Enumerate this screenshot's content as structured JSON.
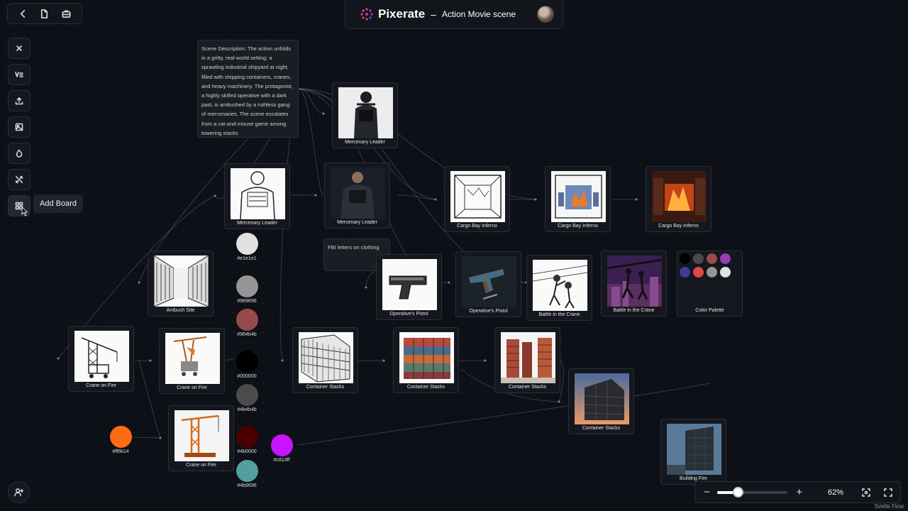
{
  "header": {
    "brand": "Pixerate",
    "separator": "–",
    "scene_title": "Action Movie scene"
  },
  "toolbar": {
    "icons": [
      "back-arrow-icon",
      "document-icon",
      "briefcase-icon"
    ]
  },
  "sidebar": {
    "items": [
      {
        "name": "close-icon"
      },
      {
        "name": "text-icon"
      },
      {
        "name": "upload-icon"
      },
      {
        "name": "image-icon"
      },
      {
        "name": "drop-icon"
      },
      {
        "name": "tools-icon"
      },
      {
        "name": "add-board-icon"
      }
    ],
    "tooltip": "Add Board"
  },
  "nodes": {
    "scene_description": "Scene Description: The action unfolds in a gritty, real-world setting: a sprawling industrial shipyard at night, filled with shipping containers, cranes, and heavy machinery. The protagonist, a highly skilled operative with a dark past, is ambushed by a ruthless gang of mercenaries. The scene escalates from a cat-and-mouse game among towering stacks",
    "fbi_note": "FBI letters on clothing",
    "mercenary_leader_top": "Mercenary Leader",
    "mercenary_leader_sketch": "Mercenary Leader",
    "mercenary_leader_color": "Mercenary Leader",
    "cargo_bay_1": "Cargo Bay Inferno",
    "cargo_bay_2": "Cargo Bay Inferno",
    "cargo_bay_3": "Cargo Bay Inferno",
    "ambush_site": "Ambush Site",
    "pistol_1": "Operative's Pistol",
    "pistol_2": "Operative's Pistol",
    "battle_crane_1": "Battle in the Crane",
    "battle_crane_2": "Battle in the Crane",
    "color_palette": "Color Palette",
    "crane_fire_1": "Crane on Fire",
    "crane_fire_2": "Crane on Fire",
    "crane_fire_3": "Crane on Fire",
    "container_stacks_1": "Container Stacks",
    "container_stacks_2": "Container Stacks",
    "container_stacks_3": "Container Stacks",
    "container_stacks_4": "Container Stacks",
    "building_fire": "Building Fire"
  },
  "swatches": {
    "s1": {
      "hex": "#e1e1e1",
      "color": "#e1e1e1"
    },
    "s2": {
      "hex": "#969696",
      "color": "#969696"
    },
    "s3": {
      "hex": "#964b4b",
      "color": "#964b4b"
    },
    "s4": {
      "hex": "#000000",
      "color": "#000000"
    },
    "s5": {
      "hex": "#4b4b4b",
      "color": "#4b4b4b"
    },
    "s6": {
      "hex": "#4b0000",
      "color": "#4b0000"
    },
    "s7": {
      "hex": "#4b9696",
      "color": "#4b9696"
    },
    "s8": {
      "hex": "#ff6b14",
      "color": "#ff6b14"
    },
    "s9": {
      "hex": "#c814ff",
      "color": "#c814ff"
    }
  },
  "palette_colors": [
    "#000000",
    "#4b4b4b",
    "#964b4b",
    "#963cb4",
    "#3c3c96",
    "#e04848",
    "#969696",
    "#e1e1e1"
  ],
  "zoom": {
    "minus": "−",
    "plus": "+",
    "value": "62%",
    "level": 0.3
  },
  "attribution": "Svelte Flow"
}
